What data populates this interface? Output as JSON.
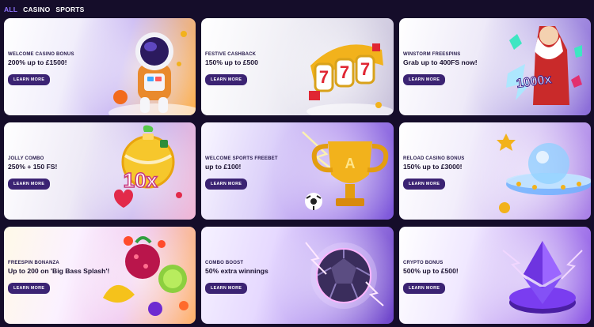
{
  "tabs": [
    {
      "label": "ALL",
      "active": true
    },
    {
      "label": "CASINO",
      "active": false
    },
    {
      "label": "SPORTS",
      "active": false
    }
  ],
  "cards": [
    {
      "eyebrow": "WELCOME CASINO BONUS",
      "headline": "200% up to £1500!",
      "button": "LEARN MORE",
      "icon": "astronaut-icon"
    },
    {
      "eyebrow": "FESTIVE CASHBACK",
      "headline": "150% up to £500",
      "button": "LEARN MORE",
      "icon": "slot-reels-icon"
    },
    {
      "eyebrow": "WINSTORM FREESPINS",
      "headline": "Grab up to 400FS now!",
      "button": "LEARN MORE",
      "icon": "zeus-1000x-icon",
      "badge": "1000x"
    },
    {
      "eyebrow": "JOLLY COMBO",
      "headline": "250% + 150 FS!",
      "button": "LEARN MORE",
      "icon": "ornament-10x-icon",
      "badge": "10x"
    },
    {
      "eyebrow": "WELCOME SPORTS FREEBET",
      "headline": "up to £100!",
      "button": "LEARN MORE",
      "icon": "trophy-icon"
    },
    {
      "eyebrow": "RELOAD CASINO BONUS",
      "headline": "150% up to £3000!",
      "button": "LEARN MORE",
      "icon": "ufo-icon"
    },
    {
      "eyebrow": "FREESPIN BONANZA",
      "headline": "Up to 200 on 'Big Bass Splash'!",
      "button": "LEARN MORE",
      "icon": "fruits-icon"
    },
    {
      "eyebrow": "COMBO BOOST",
      "headline": "50% extra winnings",
      "button": "LEARN MORE",
      "icon": "crystal-ball-icon"
    },
    {
      "eyebrow": "CRYPTO BONUS",
      "headline": "500% up to £500!",
      "button": "LEARN MORE",
      "icon": "ethereum-coin-icon"
    }
  ],
  "colors": {
    "page_bg": "#150d2a",
    "active_tab": "#8f74ff",
    "button_bg": "#3b2373",
    "gold": "#f2b21c",
    "purple": "#7a3df0"
  }
}
